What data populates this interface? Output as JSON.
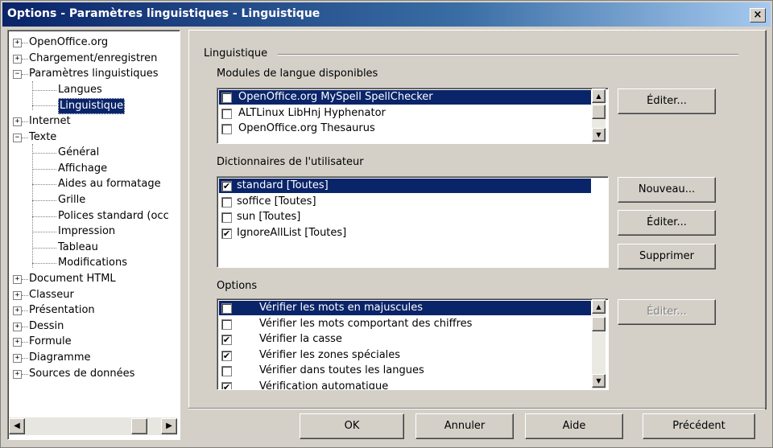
{
  "window": {
    "title": "Options - Paramètres linguistiques - Linguistique",
    "close_label": "×"
  },
  "tree": {
    "items": [
      {
        "label": "OpenOffice.org",
        "expander": "+"
      },
      {
        "label": "Chargement/enregistren",
        "expander": "+"
      },
      {
        "label": "Paramètres linguistiques",
        "expander": "−"
      },
      {
        "label": "Langues"
      },
      {
        "label": "Linguistique",
        "selected": true
      },
      {
        "label": "Internet",
        "expander": "+"
      },
      {
        "label": "Texte",
        "expander": "−"
      },
      {
        "label": "Général"
      },
      {
        "label": "Affichage"
      },
      {
        "label": "Aides au formatage"
      },
      {
        "label": "Grille"
      },
      {
        "label": "Polices standard (occ"
      },
      {
        "label": "Impression"
      },
      {
        "label": "Tableau"
      },
      {
        "label": "Modifications"
      },
      {
        "label": "Document HTML",
        "expander": "+"
      },
      {
        "label": "Classeur",
        "expander": "+"
      },
      {
        "label": "Présentation",
        "expander": "+"
      },
      {
        "label": "Dessin",
        "expander": "+"
      },
      {
        "label": "Formule",
        "expander": "+"
      },
      {
        "label": "Diagramme",
        "expander": "+"
      },
      {
        "label": "Sources de données",
        "expander": "+"
      }
    ],
    "scroll_left": "◀",
    "scroll_right": "▶"
  },
  "linguistics": {
    "group_title": "Linguistique",
    "modules": {
      "label": "Modules de langue disponibles",
      "items": [
        {
          "label": "OpenOffice.org MySpell SpellChecker",
          "checked": false,
          "selected": true
        },
        {
          "label": "ALTLinux LibHnj Hyphenator",
          "checked": false
        },
        {
          "label": "OpenOffice.org Thesaurus",
          "checked": false
        }
      ],
      "edit_button": "Éditer..."
    },
    "dictionaries": {
      "label": "Dictionnaires de l'utilisateur",
      "items": [
        {
          "label": "standard [Toutes]",
          "checked": true,
          "selected": true
        },
        {
          "label": "soffice [Toutes]",
          "checked": false
        },
        {
          "label": "sun [Toutes]",
          "checked": false
        },
        {
          "label": "IgnoreAllList [Toutes]",
          "checked": true
        }
      ],
      "new_button": "Nouveau...",
      "edit_button": "Éditer...",
      "delete_button": "Supprimer"
    },
    "options": {
      "label": "Options",
      "items": [
        {
          "label": "Vérifier les mots en majuscules",
          "checked": false,
          "selected": true
        },
        {
          "label": "Vérifier les mots comportant des chiffres",
          "checked": false
        },
        {
          "label": "Vérifier la casse",
          "checked": true
        },
        {
          "label": "Vérifier les zones spéciales",
          "checked": true
        },
        {
          "label": "Vérifier dans toutes les langues",
          "checked": false
        },
        {
          "label": "Vérification automatique",
          "checked": true
        }
      ],
      "edit_button": "Éditer..."
    }
  },
  "footer": {
    "ok": "OK",
    "cancel": "Annuler",
    "help": "Aide",
    "back": "Précédent"
  },
  "scroll_arrows": {
    "up": "▲",
    "down": "▼"
  },
  "check_mark": "✔"
}
